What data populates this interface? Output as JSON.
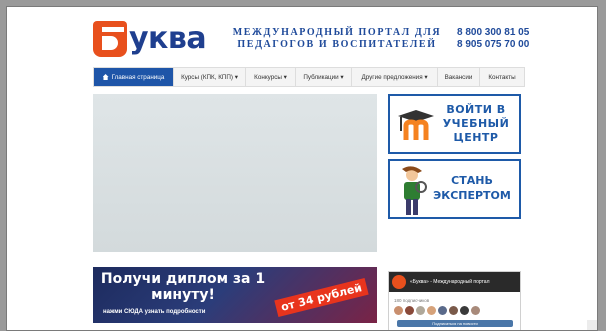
{
  "header": {
    "logo_text": "уква",
    "tagline": "МЕЖДУНАРОДНЫЙ ПОРТАЛ ДЛЯ ПЕДАГОГОВ И ВОСПИТАТЕЛЕЙ",
    "phone_1": "8 800 300 81 05",
    "phone_2": "8 905 075 70 00"
  },
  "nav": {
    "items": [
      {
        "label": "Главная страница"
      },
      {
        "label": "Курсы (КПК, КПП) ▾"
      },
      {
        "label": "Конкурсы ▾"
      },
      {
        "label": "Публикации ▾"
      },
      {
        "label": "Другие предложения ▾"
      },
      {
        "label": "Вакансии"
      },
      {
        "label": "Контакты"
      }
    ]
  },
  "cards": {
    "login": "ВОЙТИ В УЧЕБНЫЙ ЦЕНТР",
    "expert": "СТАНЬ ЭКСПЕРТОМ"
  },
  "promo": {
    "title": "Получи диплом за 1 минуту!",
    "subtitle": "нажми СЮДА узнать подробности",
    "price": "от 34 рублей"
  },
  "vk_widget": {
    "name": "«Буква» - Международный портал",
    "members": "180 подписчиков",
    "button": "Подписаться на новости"
  },
  "colors": {
    "brand_blue": "#1e55a8",
    "brand_orange": "#e8501d"
  }
}
